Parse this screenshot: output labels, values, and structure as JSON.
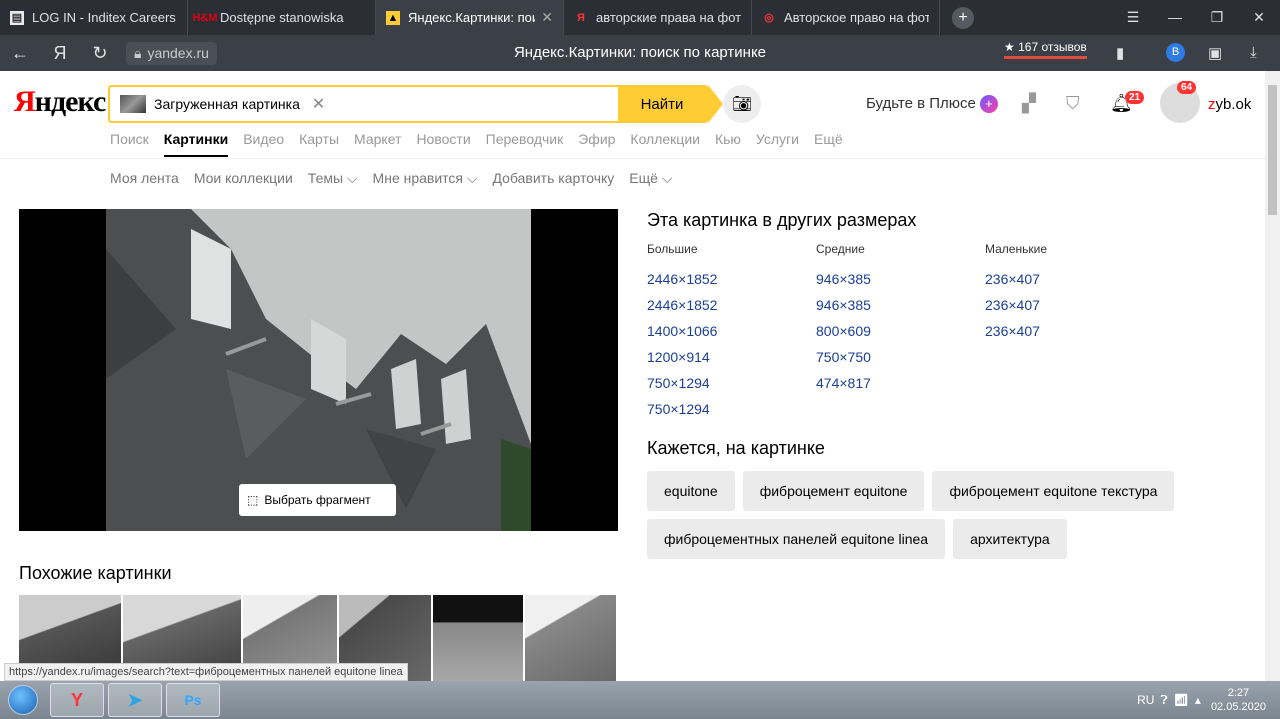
{
  "tabs": [
    {
      "label": "LOG IN - Inditex Careers",
      "icon": "document-icon"
    },
    {
      "label": "Dostępne stanowiska",
      "icon": "hm-icon"
    },
    {
      "label": "Яндекс.Картинки: поис",
      "icon": "image-icon"
    },
    {
      "label": "авторские права на фото",
      "icon": "yandex-icon"
    },
    {
      "label": "Авторское право на фото",
      "icon": "target-icon"
    }
  ],
  "address": {
    "host": "yandex.ru",
    "title": "Яндекс.Картинки: поиск по картинке",
    "reviews": "★ 167 отзывов"
  },
  "header": {
    "logo_black": "Яндекс",
    "search_chip": "Загруженная картинка",
    "find": "Найти",
    "plus": "Будьте в Плюсе",
    "bell_count": "21",
    "avatar_count": "64",
    "user_first": "z",
    "user_rest": "yb.ok"
  },
  "services": [
    "Поиск",
    "Картинки",
    "Видео",
    "Карты",
    "Маркет",
    "Новости",
    "Переводчик",
    "Эфир",
    "Коллекции",
    "Кью",
    "Услуги",
    "Ещё"
  ],
  "subnav": [
    "Моя лента",
    "Мои коллекции",
    "Темы ⌵",
    "Мне нравится ⌵",
    "Добавить карточку",
    "Ещё ⌵"
  ],
  "fragment": "Выбрать фрагмент",
  "sizes": {
    "heading": "Эта картинка в других размерах",
    "large": {
      "label": "Большие",
      "items": [
        "2446×1852",
        "2446×1852",
        "1400×1066",
        "1200×914",
        "750×1294",
        "750×1294"
      ]
    },
    "medium": {
      "label": "Средние",
      "items": [
        "946×385",
        "946×385",
        "800×609",
        "750×750",
        "474×817"
      ]
    },
    "small": {
      "label": "Маленькие",
      "items": [
        "236×407",
        "236×407",
        "236×407"
      ]
    }
  },
  "seems": {
    "heading": "Кажется, на картинке",
    "tags": [
      "equitone",
      "фиброцемент equitone",
      "фиброцемент equitone текстура",
      "фиброцементных панелей equitone linea",
      "архитектура"
    ]
  },
  "similar": "Похожие картинки",
  "status_url": "https://yandex.ru/images/search?text=фиброцементных панелей equitone linea",
  "taskbar": {
    "lang": "RU",
    "time": "2:27",
    "date": "02.05.2020"
  },
  "colors": {
    "accent": "#ffcc33",
    "link": "#1b3f95",
    "brand_red": "#ff0000"
  }
}
